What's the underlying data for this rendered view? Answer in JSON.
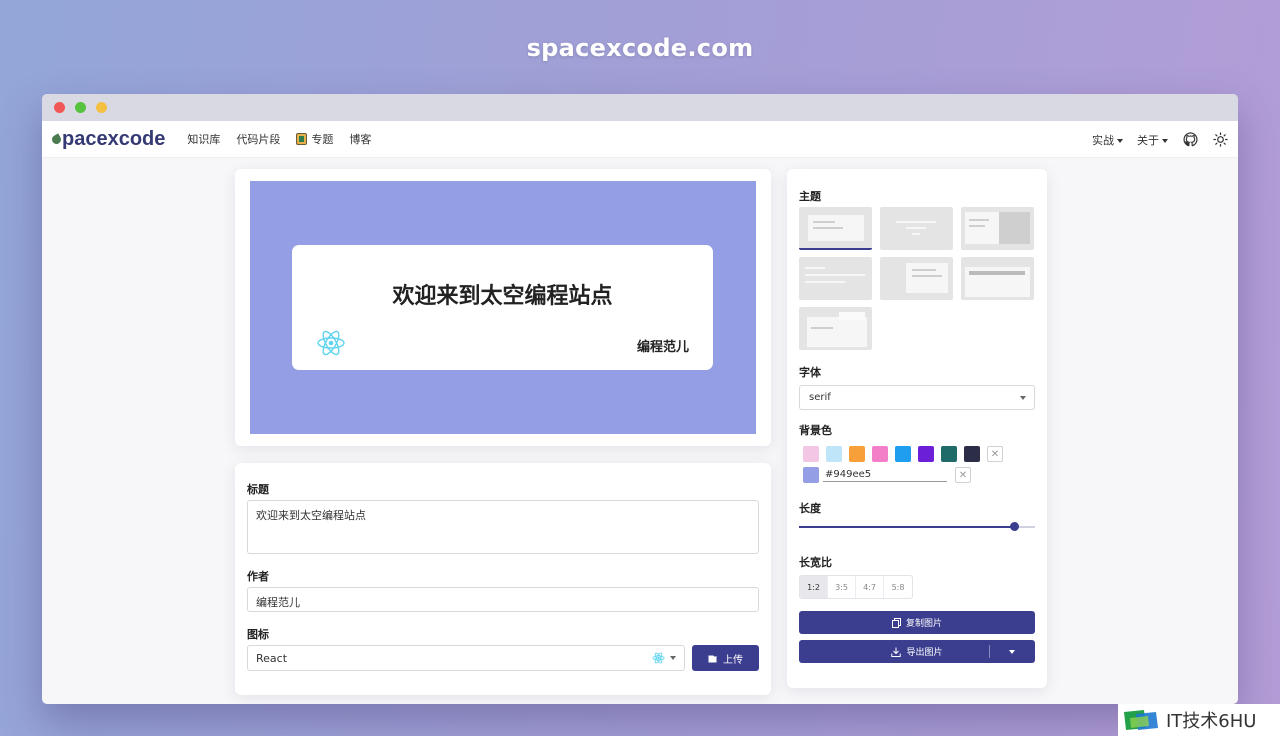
{
  "site_title": "spacexcode.com",
  "nav": {
    "logo": "pacexcode",
    "links": [
      "知识库",
      "代码片段",
      "专题",
      "博客"
    ],
    "right_menus": [
      "实战",
      "关于"
    ]
  },
  "preview": {
    "title": "欢迎来到太空编程站点",
    "author": "编程范儿",
    "background": "#949ee5"
  },
  "form": {
    "title_label": "标题",
    "title_value": "欢迎来到太空编程站点",
    "author_label": "作者",
    "author_value": "编程范儿",
    "icon_label": "图标",
    "icon_value": "React",
    "upload_label": "上传"
  },
  "settings": {
    "theme_label": "主题",
    "font_label": "字体",
    "font_value": "serif",
    "bg_label": "背景色",
    "bg_swatches": [
      "#f3c6e6",
      "#bfe6f8",
      "#f7a03a",
      "#f27fc8",
      "#1f9ef0",
      "#6b1fd6",
      "#1e6b6a",
      "#2b2e46"
    ],
    "bg_hex": "#949ee5",
    "length_label": "长度",
    "length_value": 0.91,
    "ratio_label": "长宽比",
    "ratios": [
      "1:2",
      "3:5",
      "4:7",
      "5:8"
    ],
    "copy_label": "复制图片",
    "export_label": "导出图片"
  },
  "watermark": "IT技术6HU",
  "colors": {
    "primary": "#3b3e8f",
    "accent_bg": "#949ee5"
  }
}
